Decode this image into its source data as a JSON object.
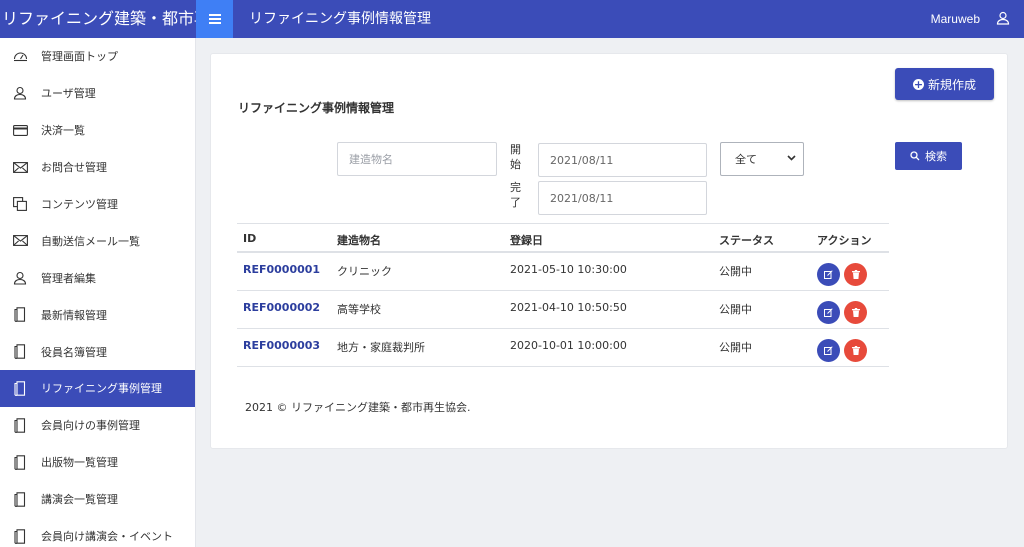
{
  "app": {
    "brand": "リファイニング建築・都市再",
    "page_header": "リファイニング事例情報管理",
    "user": "Maruweb"
  },
  "sidebar": {
    "items": [
      {
        "label": "管理画面トップ",
        "icon": "dashboard-icon"
      },
      {
        "label": "ユーザ管理",
        "icon": "user-icon"
      },
      {
        "label": "決済一覧",
        "icon": "credit-card-icon"
      },
      {
        "label": "お問合せ管理",
        "icon": "mail-icon"
      },
      {
        "label": "コンテンツ管理",
        "icon": "copy-icon"
      },
      {
        "label": "自動送信メール一覧",
        "icon": "mail-icon"
      },
      {
        "label": "管理者編集",
        "icon": "user-icon"
      },
      {
        "label": "最新情報管理",
        "icon": "document-icon"
      },
      {
        "label": "役員名簿管理",
        "icon": "document-icon"
      },
      {
        "label": "リファイニング事例管理",
        "icon": "document-icon",
        "active": true
      },
      {
        "label": "会員向けの事例管理",
        "icon": "document-icon"
      },
      {
        "label": "出版物一覧管理",
        "icon": "document-icon"
      },
      {
        "label": "講演会一覧管理",
        "icon": "document-icon"
      },
      {
        "label": "会員向け講演会・イベント",
        "icon": "document-icon"
      }
    ]
  },
  "main": {
    "title": "リファイニング事例情報管理",
    "new_button": "新規作成",
    "search": {
      "building_placeholder": "建造物名",
      "start_label": "開始",
      "end_label": "完了",
      "start_date": "2021/08/11",
      "end_date": "2021/08/11",
      "status_selected": "全て",
      "search_button": "検索"
    },
    "table": {
      "headers": [
        "ID",
        "建造物名",
        "登録日",
        "ステータス",
        "アクション"
      ],
      "rows": [
        {
          "id": "REF0000001",
          "name": "クリニック",
          "date": "2021-05-10 10:30:00",
          "status": "公開中"
        },
        {
          "id": "REF0000002",
          "name": "高等学校",
          "date": "2021-04-10 10:50:50",
          "status": "公開中"
        },
        {
          "id": "REF0000003",
          "name": "地方・家庭裁判所",
          "date": "2020-10-01 10:00:00",
          "status": "公開中"
        }
      ]
    },
    "footer": "2021 © リファイニング建築・都市再生協会."
  },
  "colors": {
    "primary": "#3b4cb8",
    "menu_button": "#3f7ff5",
    "danger": "#e74a3b"
  }
}
